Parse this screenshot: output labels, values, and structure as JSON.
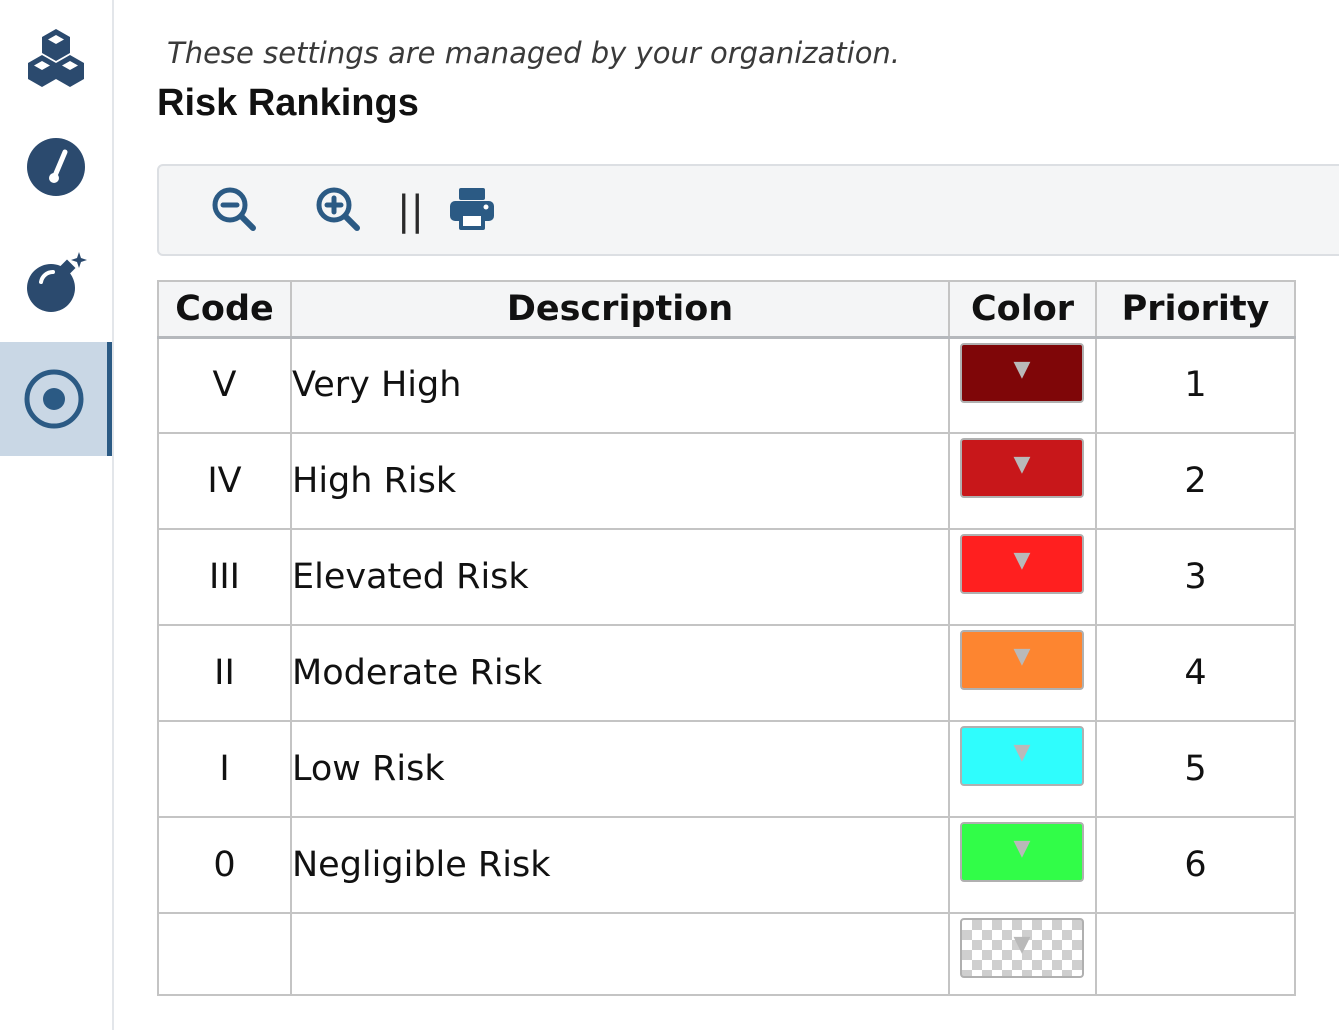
{
  "sidebar": {
    "items": [
      {
        "icon": "cubes-icon",
        "active": false
      },
      {
        "icon": "gauge-icon",
        "active": false
      },
      {
        "icon": "bomb-icon",
        "active": false
      },
      {
        "icon": "target-icon",
        "active": true
      }
    ],
    "accent": "#2b5a84"
  },
  "notice": "These settings are managed by your organization.",
  "page_title": "Risk Rankings",
  "toolbar": {
    "zoom_out_icon": "zoom-out-icon",
    "zoom_in_icon": "zoom-in-icon",
    "separator": "||",
    "print_icon": "print-icon"
  },
  "table": {
    "headers": {
      "code": "Code",
      "description": "Description",
      "color": "Color",
      "priority": "Priority"
    },
    "rows": [
      {
        "code": "V",
        "description": "Very High",
        "color": "#7f0608",
        "priority": "1"
      },
      {
        "code": "IV",
        "description": "High Risk",
        "color": "#c8171a",
        "priority": "2"
      },
      {
        "code": "III",
        "description": "Elevated Risk",
        "color": "#ff1f1f",
        "priority": "3"
      },
      {
        "code": "II",
        "description": "Moderate Risk",
        "color": "#fd8530",
        "priority": "4"
      },
      {
        "code": "I",
        "description": "Low Risk",
        "color": "#2ffdfd",
        "priority": "5"
      },
      {
        "code": "0",
        "description": "Negligible Risk",
        "color": "#31fd48",
        "priority": "6"
      }
    ],
    "dropdown_glyph": "▼"
  }
}
